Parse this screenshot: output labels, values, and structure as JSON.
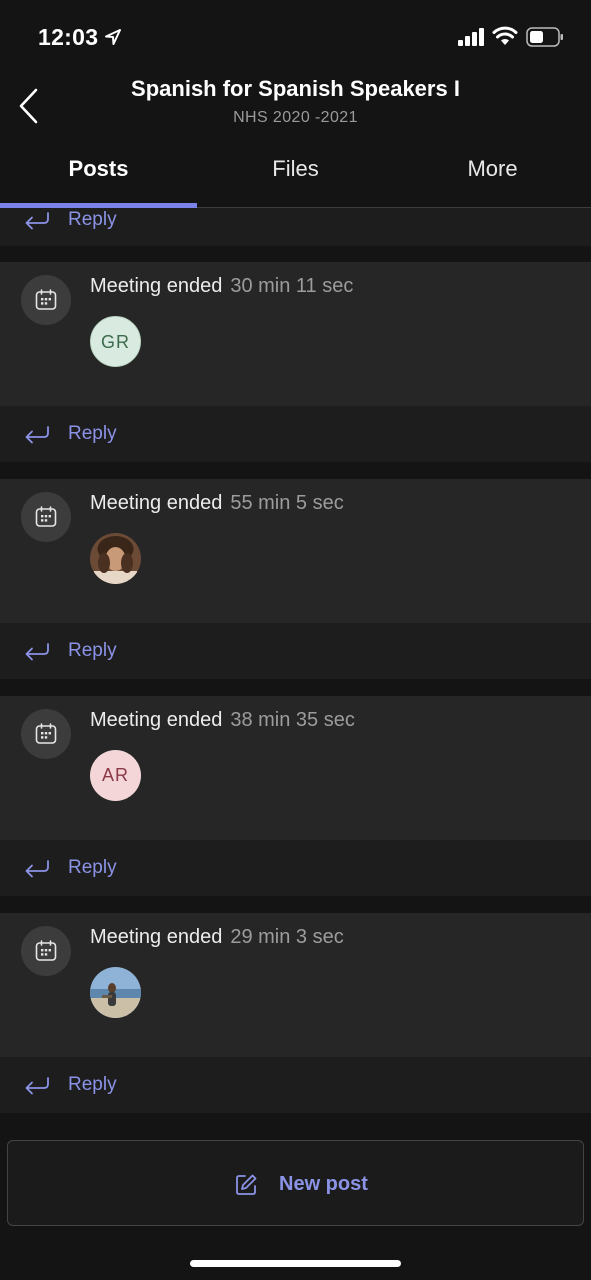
{
  "status_bar": {
    "time": "12:03",
    "icons": [
      "location-arrow-icon",
      "cellular-signal-icon",
      "wifi-icon",
      "battery-icon"
    ]
  },
  "header": {
    "title": "Spanish for Spanish Speakers I",
    "subtitle": "NHS 2020 -2021",
    "back_icon": "chevron-left-icon"
  },
  "tabs": [
    {
      "label": "Posts",
      "active": true
    },
    {
      "label": "Files",
      "active": false
    },
    {
      "label": "More",
      "active": false
    }
  ],
  "feed": {
    "top_reply_label": "Reply",
    "posts": [
      {
        "icon": "calendar-icon",
        "event": "Meeting ended",
        "duration": "30 min 11 sec",
        "avatar": {
          "type": "initials",
          "initials": "GR",
          "bg": "#d9ebe0",
          "fg": "#3d6b4c"
        },
        "reply_label": "Reply"
      },
      {
        "icon": "calendar-icon",
        "event": "Meeting ended",
        "duration": "55 min 5 sec",
        "avatar": {
          "type": "photo",
          "initials": ""
        },
        "reply_label": "Reply"
      },
      {
        "icon": "calendar-icon",
        "event": "Meeting ended",
        "duration": "38 min 35 sec",
        "avatar": {
          "type": "initials",
          "initials": "AR",
          "bg": "#f4d6d9",
          "fg": "#8a3a47"
        },
        "reply_label": "Reply"
      },
      {
        "icon": "calendar-icon",
        "event": "Meeting ended",
        "duration": "29 min 3 sec",
        "avatar": {
          "type": "photo",
          "initials": ""
        },
        "reply_label": "Reply"
      }
    ]
  },
  "new_post": {
    "label": "New post",
    "icon": "compose-icon"
  },
  "colors": {
    "accent": "#7b83eb",
    "link": "#8b93e6",
    "background": "#141414",
    "card": "#262626"
  }
}
